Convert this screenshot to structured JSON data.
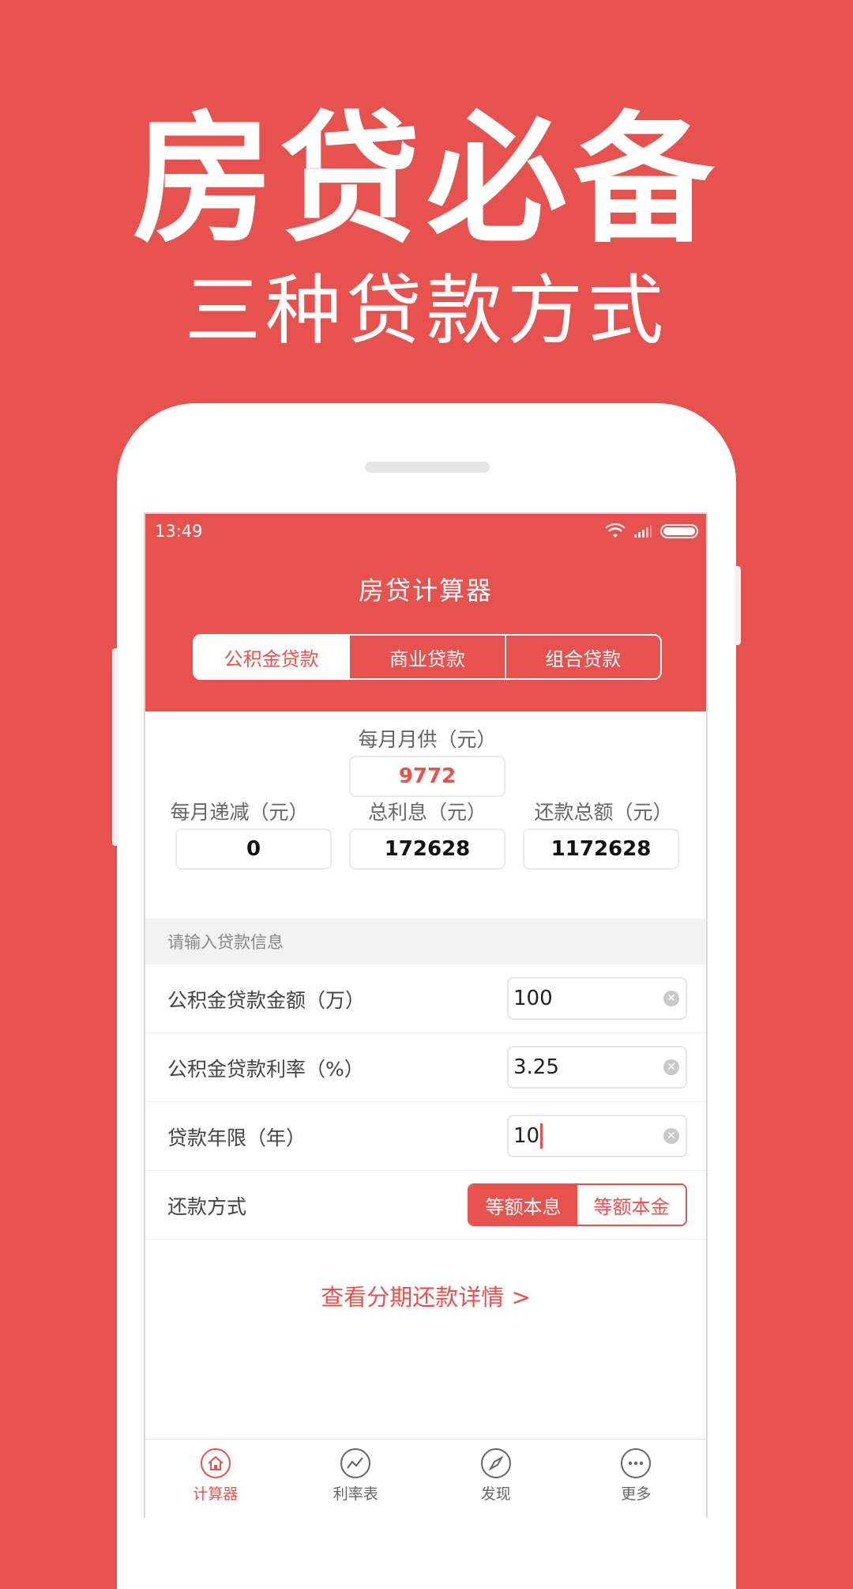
{
  "promo": {
    "title": "房贷必备",
    "subtitle": "三种贷款方式"
  },
  "status_bar": {
    "time": "13:49"
  },
  "app": {
    "title": "房贷计算器",
    "tabs": [
      "公积金贷款",
      "商业贷款",
      "组合贷款"
    ],
    "active_tab": 0
  },
  "results": {
    "monthly_payment_label": "每月月供（元）",
    "monthly_payment_value": "9772",
    "monthly_decrease_label": "每月递减（元）",
    "monthly_decrease_value": "0",
    "total_interest_label": "总利息（元）",
    "total_interest_value": "172628",
    "total_repayment_label": "还款总额（元）",
    "total_repayment_value": "1172628"
  },
  "form": {
    "section_title": "请输入贷款信息",
    "amount_label": "公积金贷款金额（万）",
    "amount_value": "100",
    "rate_label": "公积金贷款利率（%）",
    "rate_value": "3.25",
    "years_label": "贷款年限（年）",
    "years_value": "10",
    "repay_label": "还款方式",
    "repay_options": [
      "等额本息",
      "等额本金"
    ],
    "repay_selected": 0
  },
  "detail_link": "查看分期还款详情 >",
  "bottom_nav": {
    "items": [
      {
        "label": "计算器",
        "icon": "home-icon"
      },
      {
        "label": "利率表",
        "icon": "trend-chart-icon"
      },
      {
        "label": "发现",
        "icon": "compass-icon"
      },
      {
        "label": "更多",
        "icon": "more-dots-icon"
      }
    ],
    "active": 0
  },
  "colors": {
    "accent": "#e8524e",
    "background": "#e8524e",
    "section_bg": "#f2f2f2"
  }
}
